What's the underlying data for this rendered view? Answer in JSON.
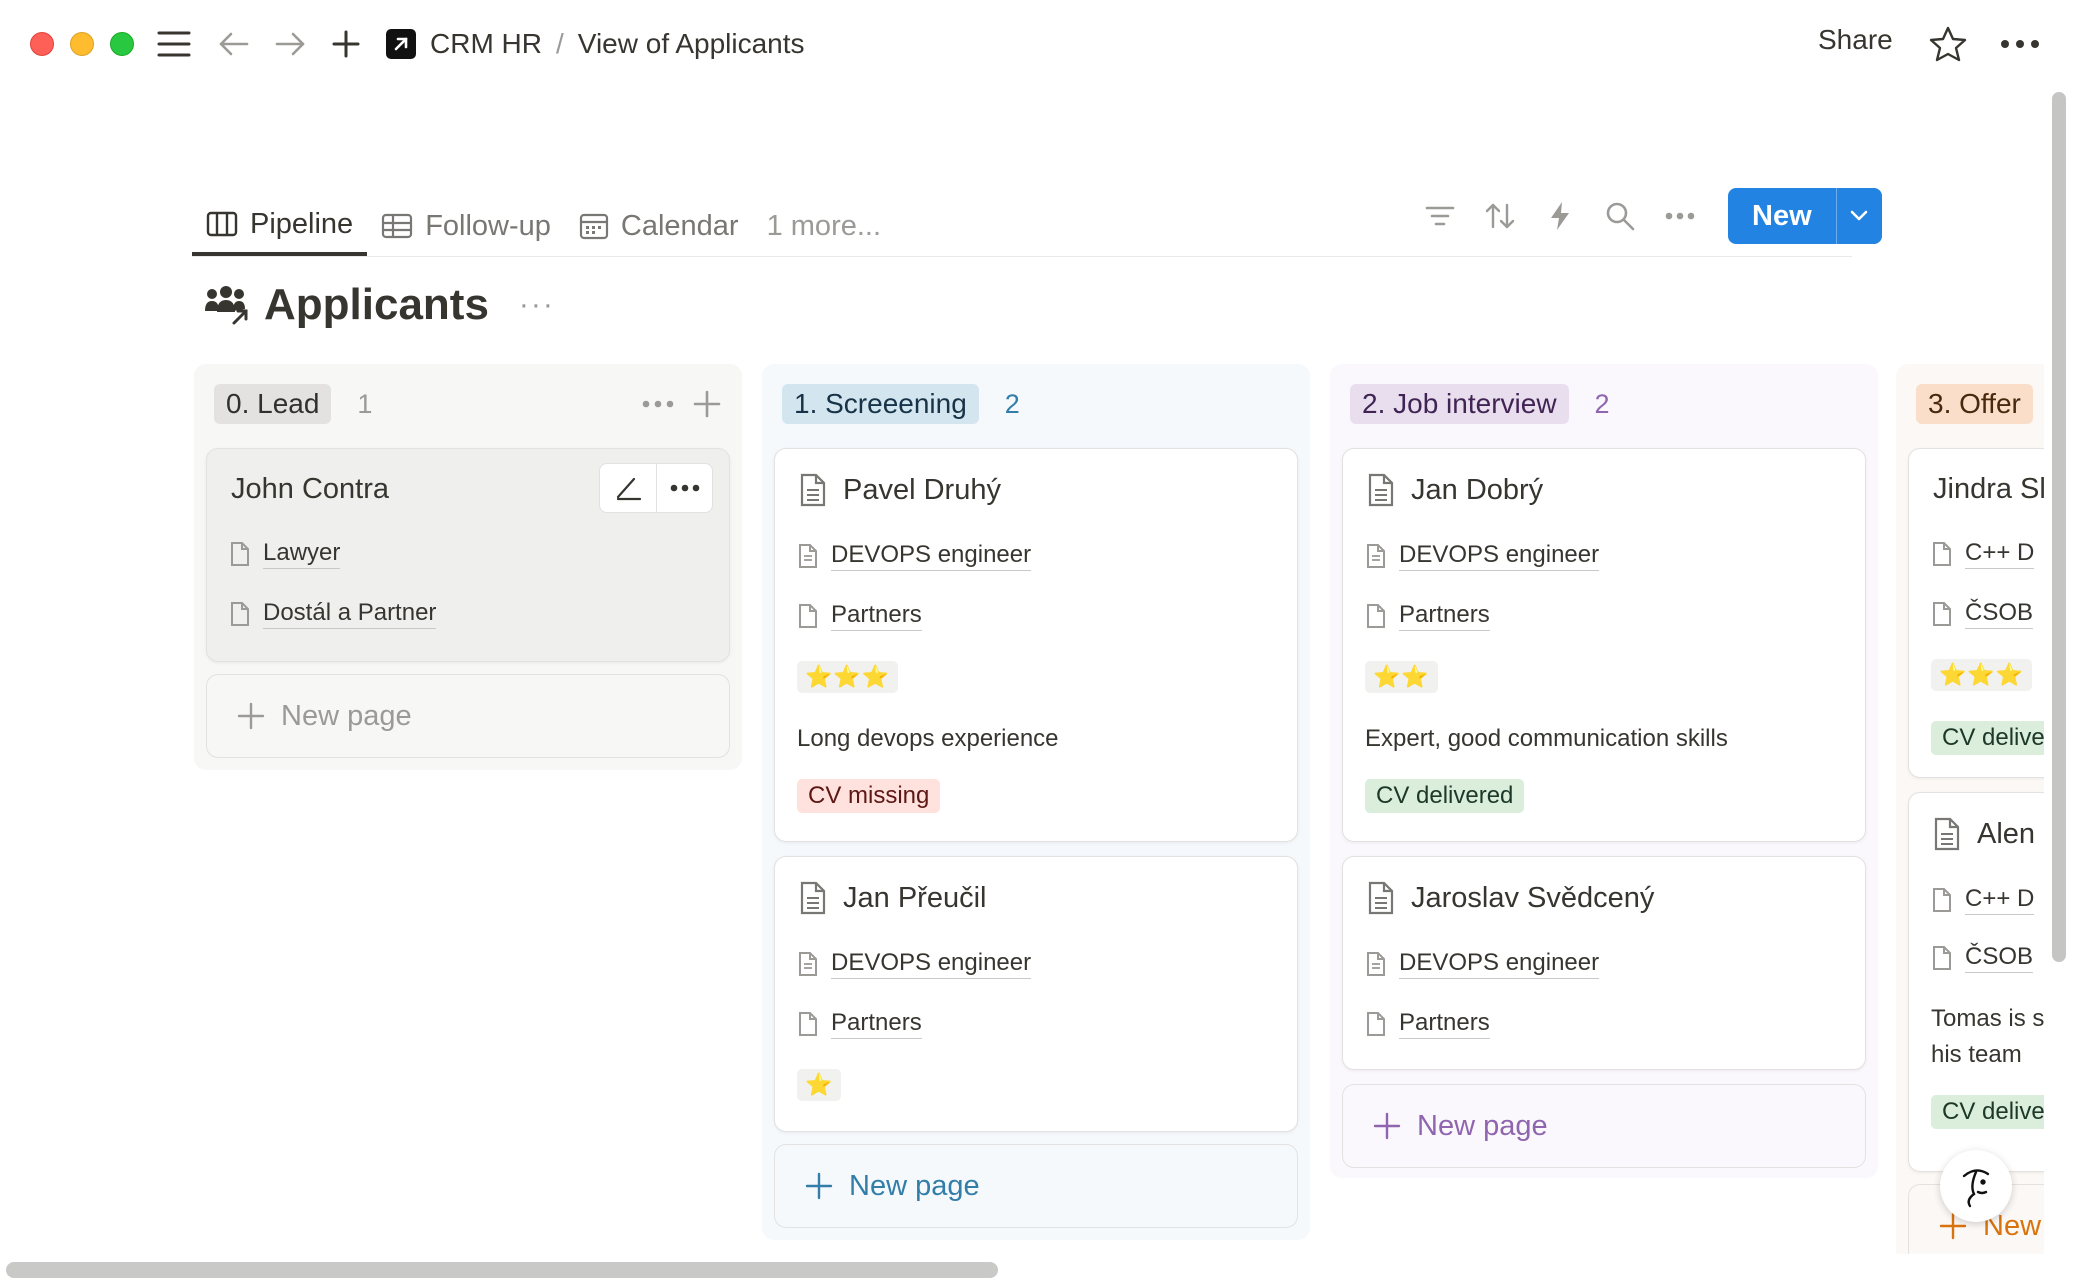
{
  "breadcrumb": {
    "workspace": "CRM HR",
    "separator": "/",
    "page": "View of Applicants"
  },
  "topbar": {
    "share_label": "Share"
  },
  "tabs": [
    {
      "label": "Pipeline",
      "icon": "board-icon"
    },
    {
      "label": "Follow-up",
      "icon": "table-icon"
    },
    {
      "label": "Calendar",
      "icon": "calendar-icon"
    },
    {
      "label": "1 more..."
    }
  ],
  "toolbar": {
    "new_label": "New"
  },
  "database": {
    "title": "Applicants",
    "more": "···"
  },
  "columns": [
    {
      "label": "0. Lead",
      "count": "1",
      "colors": {
        "bg": "#f7f7f5",
        "pill": "#e3e2e0",
        "pill_text": "#32302c",
        "count": "#9b9a97"
      },
      "cards": [
        {
          "name": "John Contra",
          "position": "Lawyer",
          "company": "Dostál a Partner"
        }
      ],
      "new_page": "New page"
    },
    {
      "label": "1. Screeening",
      "count": "2",
      "colors": {
        "bg": "#f5f9fc",
        "pill": "#d3e5ef",
        "pill_text": "#183347",
        "count": "#337ea9"
      },
      "cards": [
        {
          "name": "Pavel Druhý",
          "position": "DEVOPS engineer",
          "company": "Partners",
          "rating": "⭐⭐⭐",
          "note": "Long devops experience",
          "status": "CV missing"
        },
        {
          "name": "Jan Přeučil",
          "position": "DEVOPS engineer",
          "company": "Partners",
          "rating": "⭐"
        }
      ],
      "new_page": "New page"
    },
    {
      "label": "2. Job interview",
      "count": "2",
      "colors": {
        "bg": "#faf8fc",
        "pill": "#e8deee",
        "pill_text": "#412454",
        "count": "#9065b0"
      },
      "cards": [
        {
          "name": "Jan Dobrý",
          "position": "DEVOPS engineer",
          "company": "Partners",
          "rating": "⭐⭐",
          "note": "Expert, good communication skills",
          "status": "CV delivered"
        },
        {
          "name": "Jaroslav Svědcený",
          "position": "DEVOPS engineer",
          "company": "Partners"
        }
      ],
      "new_page": "New page"
    },
    {
      "label": "3. Offer",
      "count": "",
      "colors": {
        "bg": "#fcf8f5",
        "pill": "#fadec9",
        "pill_text": "#49290e",
        "count": "#d9730d"
      },
      "cards": [
        {
          "name": "Jindra Sl",
          "position": "C++ D",
          "company": "ČSOB",
          "rating": "⭐⭐⭐",
          "status": "CV delive"
        },
        {
          "name": "Alen",
          "position": "C++ D",
          "company": "ČSOB",
          "note": "Tomas is s",
          "note2": "his team",
          "status": "CV delive"
        }
      ],
      "new_page": "New"
    }
  ]
}
